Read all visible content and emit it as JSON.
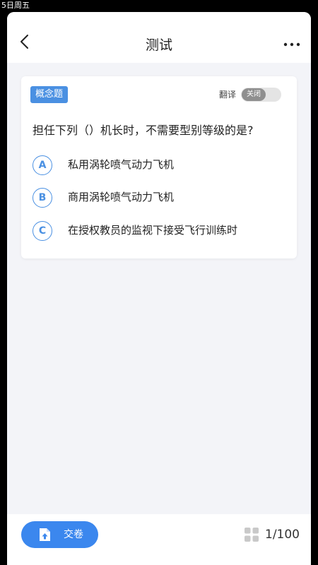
{
  "status_bar": {
    "text": "5日周五"
  },
  "header": {
    "title": "测试"
  },
  "question": {
    "type_badge": "概念题",
    "translate_label": "翻译",
    "translate_state": "关闭",
    "text": "担任下列（）机长时，不需要型别等级的是?",
    "options": [
      {
        "letter": "A",
        "text": "私用涡轮喷气动力飞机"
      },
      {
        "letter": "B",
        "text": "商用涡轮喷气动力飞机"
      },
      {
        "letter": "C",
        "text": "在授权教员的监视下接受飞行训练时"
      }
    ]
  },
  "footer": {
    "submit_label": "交卷",
    "progress": "1/100"
  },
  "colors": {
    "accent": "#4a90e2",
    "submit": "#3b87ee",
    "background": "#f3f4f8"
  },
  "icons": {
    "back": "chevron-left-icon",
    "more": "more-dots-icon",
    "submit": "document-upload-icon",
    "grid": "grid-icon"
  }
}
